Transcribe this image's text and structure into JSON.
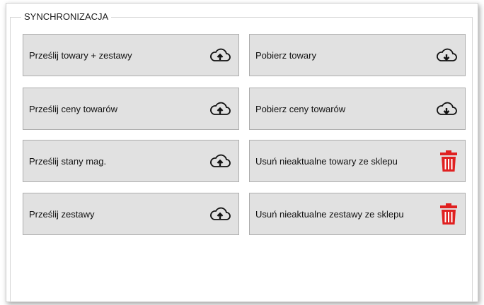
{
  "group": {
    "title": "SYNCHRONIZACJA"
  },
  "buttons": {
    "send_products_sets": {
      "label": "Prześlij towary + zestawy",
      "icon": "cloud-upload-icon"
    },
    "send_prices": {
      "label": "Prześlij ceny towarów",
      "icon": "cloud-upload-icon"
    },
    "send_stock": {
      "label": "Prześlij stany mag.",
      "icon": "cloud-upload-icon"
    },
    "send_sets": {
      "label": "Prześlij zestawy",
      "icon": "cloud-upload-icon"
    },
    "get_products": {
      "label": "Pobierz towary",
      "icon": "cloud-download-icon"
    },
    "get_prices": {
      "label": "Pobierz ceny towarów",
      "icon": "cloud-download-icon"
    },
    "delete_old_products": {
      "label": "Usuń nieaktualne towary ze sklepu",
      "icon": "trash-icon"
    },
    "delete_old_sets": {
      "label": "Usuń nieaktualne zestawy ze sklepu",
      "icon": "trash-icon"
    }
  },
  "colors": {
    "button_bg": "#e1e1e1",
    "button_border": "#adadad",
    "trash_red": "#e02020"
  }
}
